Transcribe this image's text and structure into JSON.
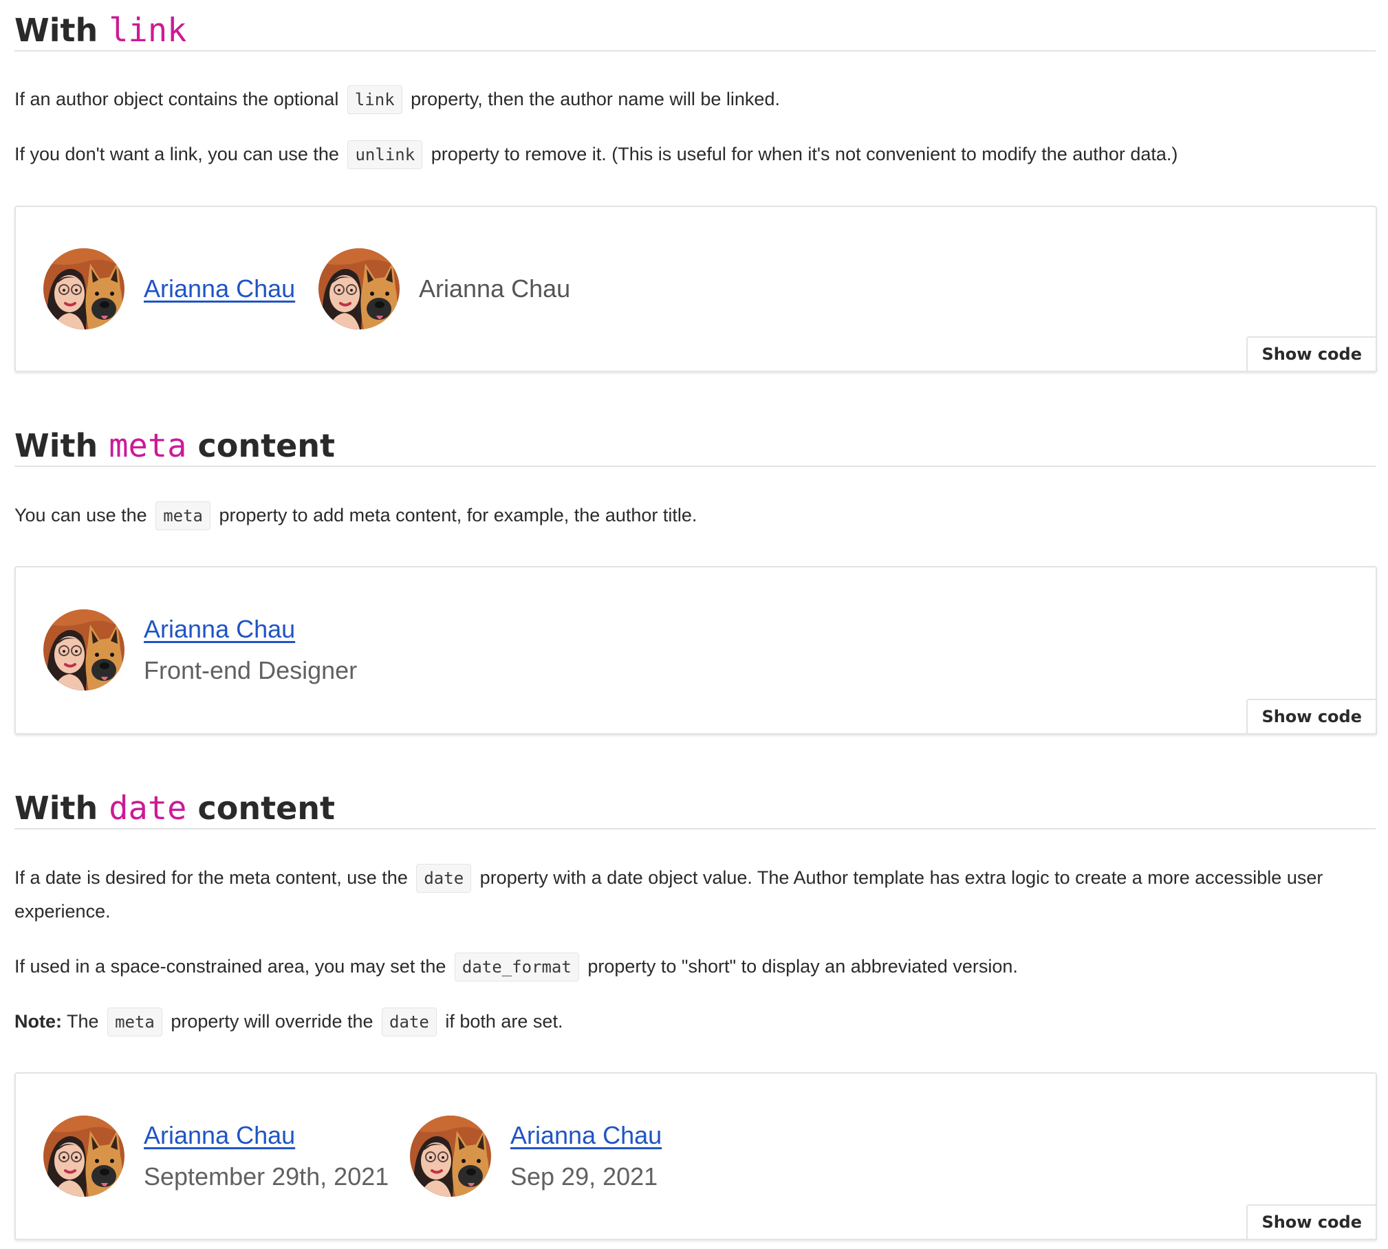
{
  "sections": [
    {
      "heading": {
        "prefix": "With ",
        "keyword": "link",
        "suffix": ""
      },
      "paragraphs": [
        {
          "before": "If an author object contains the optional",
          "code": "link",
          "after": "property, then the author name will be linked."
        },
        {
          "before": "If you don't want a link, you can use the",
          "code": "unlink",
          "after": "property to remove it. (This is useful for when it's not convenient to modify the author data.)"
        }
      ],
      "demo": {
        "authors": [
          {
            "name": "Arianna Chau",
            "linked": true,
            "meta": ""
          },
          {
            "name": "Arianna Chau",
            "linked": false,
            "meta": ""
          }
        ],
        "show_code_label": "Show code"
      }
    },
    {
      "heading": {
        "prefix": "With ",
        "keyword": "meta",
        "suffix": " content"
      },
      "paragraphs": [
        {
          "before": "You can use the",
          "code": "meta",
          "after": "property to add meta content, for example, the author title."
        }
      ],
      "demo": {
        "authors": [
          {
            "name": "Arianna Chau",
            "linked": true,
            "meta": "Front-end Designer"
          }
        ],
        "show_code_label": "Show code"
      }
    },
    {
      "heading": {
        "prefix": "With ",
        "keyword": "date",
        "suffix": " content"
      },
      "paragraphs": [
        {
          "before": "If a date is desired for the meta content, use the",
          "code": "date",
          "after": "property with a date object value. The Author template has extra logic to create a more accessible user experience."
        },
        {
          "before": "If used in a space-constrained area, you may set the",
          "code": "date_format",
          "after": "property to \"short\" to display an abbreviated version."
        },
        {
          "note_label": "Note:",
          "before": "The",
          "code": "meta",
          "middle": "property will override the",
          "code2": "date",
          "after": "if both are set."
        }
      ],
      "demo": {
        "authors": [
          {
            "name": "Arianna Chau",
            "linked": true,
            "meta": "September 29th, 2021"
          },
          {
            "name": "Arianna Chau",
            "linked": true,
            "meta": "Sep 29, 2021"
          }
        ],
        "show_code_label": "Show code"
      }
    }
  ],
  "avatar_icon": "avatar-woman-with-dog-icon",
  "colors": {
    "keyword": "#cc1a96",
    "link": "#1f54c4",
    "meta_text": "#616161",
    "border": "#e3e3e3"
  }
}
